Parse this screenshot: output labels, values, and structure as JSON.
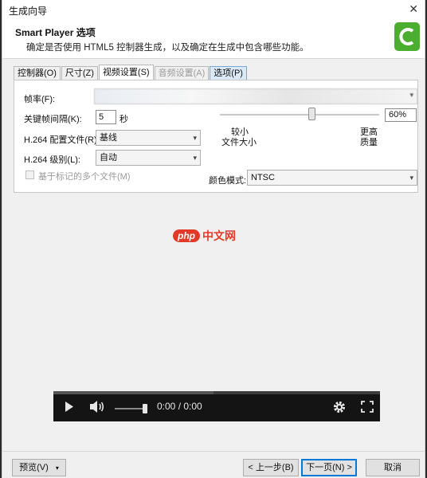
{
  "window": {
    "title": "生成向导",
    "close_glyph": "✕"
  },
  "header": {
    "title": "Smart Player 选项",
    "subtitle": "确定是否使用 HTML5 控制器生成，以及确定在生成中包含哪些功能。"
  },
  "tabs": [
    {
      "label": "控制器(O)",
      "state": "normal"
    },
    {
      "label": "尺寸(Z)",
      "state": "normal"
    },
    {
      "label": "视频设置(S)",
      "state": "active"
    },
    {
      "label": "音频设置(A)",
      "state": "disabled"
    },
    {
      "label": "选项(P)",
      "state": "hover"
    }
  ],
  "video": {
    "frame_rate_label": "帧率(F):",
    "keyframe_label": "关键帧间隔(K):",
    "keyframe_value": "5",
    "keyframe_unit": "秒",
    "profile_label": "H.264 配置文件(R):",
    "profile_value": "基线",
    "level_label": "H.264 级别(L):",
    "level_value": "自动",
    "quality_percent": "60%",
    "slider_left_label_1": "较小",
    "slider_left_label_2": "文件大小",
    "slider_right_label_1": "更高",
    "slider_right_label_2": "质量",
    "multi_file_label": "基于标记的多个文件(M)",
    "color_mode_label": "颜色模式:",
    "color_mode_value": "NTSC"
  },
  "watermark": {
    "badge": "php",
    "text": "中文网"
  },
  "player": {
    "time": "0:00 / 0:00",
    "progress_fraction": 0.49
  },
  "buttons": {
    "preview": "预览(V)",
    "back": "< 上一步(B)",
    "next": "下一页(N) >",
    "cancel": "取消"
  },
  "colors": {
    "accent": "#0078d7",
    "logo_green": "#4cae2f",
    "watermark_red": "#e33a28"
  }
}
